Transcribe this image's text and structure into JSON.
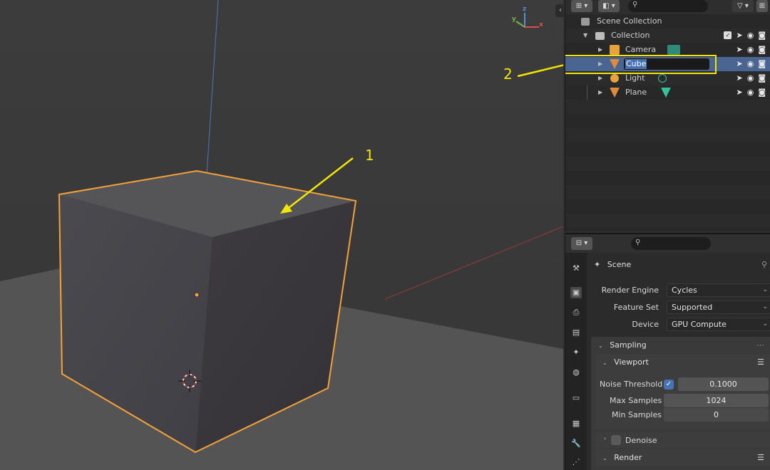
{
  "viewport": {
    "annotation_1": "1",
    "annotation_2": "2",
    "gizmo": {
      "x": "x",
      "y": "y",
      "z": "z"
    },
    "collapse_glyph": "‹"
  },
  "outliner": {
    "scene_collection": "Scene Collection",
    "collection": "Collection",
    "items": [
      {
        "label": "Camera",
        "icon": "camera-icon",
        "color": "#e6a23c"
      },
      {
        "label": "Cube",
        "icon": "mesh-icon",
        "color": "#e08a3c",
        "selected": true,
        "renaming": true
      },
      {
        "label": "Light",
        "icon": "light-icon",
        "color": "#e6a23c"
      },
      {
        "label": "Plane",
        "icon": "mesh-icon",
        "color": "#e08a3c"
      }
    ]
  },
  "properties": {
    "context": "Scene",
    "render_engine_label": "Render Engine",
    "render_engine_value": "Cycles",
    "feature_set_label": "Feature Set",
    "feature_set_value": "Supported",
    "device_label": "Device",
    "device_value": "GPU Compute",
    "sampling": "Sampling",
    "viewport": "Viewport",
    "noise_threshold_label": "Noise Threshold",
    "noise_threshold_value": "0.1000",
    "max_samples_label": "Max Samples",
    "max_samples_value": "1024",
    "min_samples_label": "Min Samples",
    "min_samples_value": "0",
    "denoise": "Denoise",
    "render": "Render"
  },
  "colors": {
    "selection_outline": "#f3a23a",
    "annotation": "#f2e600",
    "selected_row": "#4b6593",
    "accent_blue": "#4772b3"
  }
}
